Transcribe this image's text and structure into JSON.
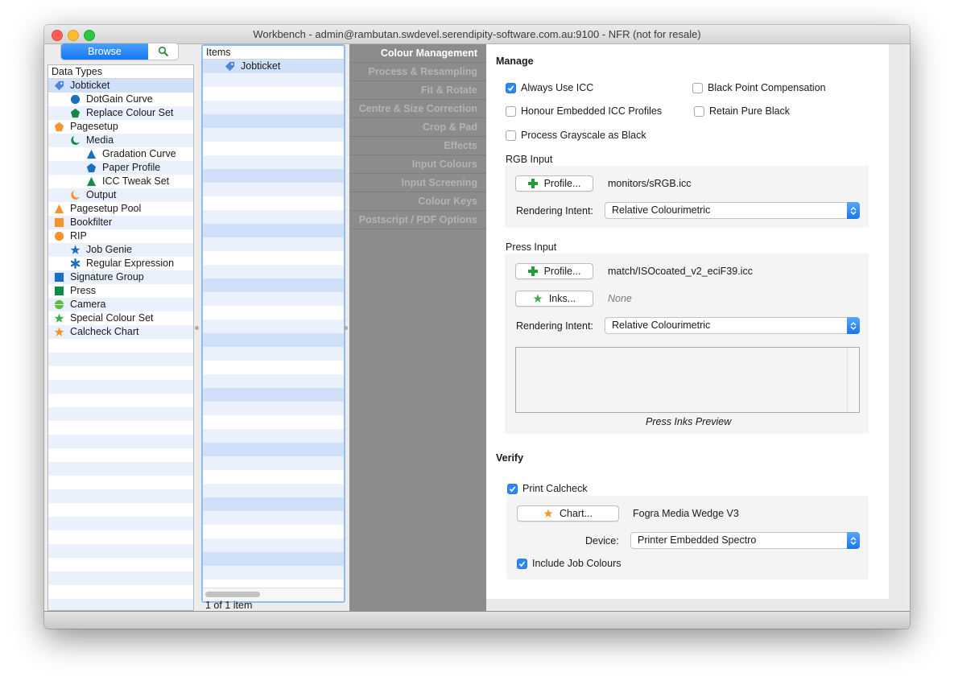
{
  "window": {
    "title": "Workbench - admin@rambutan.swdevel.serendipity-software.com.au:9100 - NFR (not for resale)"
  },
  "left_pane": {
    "browse_label": "Browse",
    "search_icon": "magnifier-icon",
    "header": "Data Types",
    "items": [
      {
        "label": "Jobticket",
        "icon": "tag-icon",
        "color": "#4f86d9",
        "indent": 0,
        "selected": true
      },
      {
        "label": "DotGain Curve",
        "icon": "circle-icon",
        "color": "#1a6fbf",
        "indent": 1
      },
      {
        "label": "Replace Colour Set",
        "icon": "pentagon-icon",
        "color": "#138a43",
        "indent": 1
      },
      {
        "label": "Pagesetup",
        "icon": "pentagon-icon",
        "color": "#f6932b",
        "indent": 0
      },
      {
        "label": "Media",
        "icon": "crescent-icon",
        "color": "#138a43",
        "indent": 1
      },
      {
        "label": "Gradation Curve",
        "icon": "triangle-icon",
        "color": "#1a6fbf",
        "indent": 2
      },
      {
        "label": "Paper Profile",
        "icon": "pentagon-icon",
        "color": "#1a6fbf",
        "indent": 2
      },
      {
        "label": "ICC Tweak Set",
        "icon": "triangle-icon",
        "color": "#138a43",
        "indent": 2
      },
      {
        "label": "Output",
        "icon": "crescent-icon",
        "color": "#f6932b",
        "indent": 1
      },
      {
        "label": "Pagesetup Pool",
        "icon": "triangle-icon",
        "color": "#f6932b",
        "indent": 0
      },
      {
        "label": "Bookfilter",
        "icon": "square-icon",
        "color": "#f6932b",
        "indent": 0
      },
      {
        "label": "RIP",
        "icon": "circle-icon",
        "color": "#f6932b",
        "indent": 0
      },
      {
        "label": "Job Genie",
        "icon": "star-icon",
        "color": "#1a6fbf",
        "indent": 1
      },
      {
        "label": "Regular Expression",
        "icon": "asterisk-icon",
        "color": "#1a6fbf",
        "indent": 1
      },
      {
        "label": "Signature Group",
        "icon": "square-icon",
        "color": "#1a6fbf",
        "indent": 0
      },
      {
        "label": "Press",
        "icon": "square-icon",
        "color": "#138a43",
        "indent": 0
      },
      {
        "label": "Camera",
        "icon": "half-circle-icon",
        "color": "#5cbf3f",
        "indent": 0
      },
      {
        "label": "Special Colour Set",
        "icon": "star-icon",
        "color": "#3fae4a",
        "indent": 0
      },
      {
        "label": "Calcheck Chart",
        "icon": "star-icon",
        "color": "#f6932b",
        "indent": 0
      }
    ]
  },
  "items_pane": {
    "header": "Items",
    "items": [
      {
        "label": "Jobticket",
        "icon": "tag-icon",
        "color": "#4f86d9",
        "selected": true
      }
    ],
    "count": "1 of 1 item"
  },
  "sections": {
    "items": [
      {
        "label": "Colour Management",
        "active": true
      },
      {
        "label": "Process & Resampling"
      },
      {
        "label": "Fit & Rotate"
      },
      {
        "label": "Centre & Size Correction"
      },
      {
        "label": "Crop & Pad"
      },
      {
        "label": "Effects"
      },
      {
        "label": "Input Colours"
      },
      {
        "label": "Input Screening"
      },
      {
        "label": "Colour Keys"
      },
      {
        "label": "Postscript / PDF Options"
      }
    ]
  },
  "manage": {
    "title": "Manage",
    "always_use_icc": {
      "label": "Always Use ICC",
      "checked": true
    },
    "black_point": {
      "label": "Black Point Compensation",
      "checked": false
    },
    "honour_embedded": {
      "label": "Honour Embedded ICC Profiles",
      "checked": false
    },
    "retain_black": {
      "label": "Retain Pure Black",
      "checked": false
    },
    "process_gray": {
      "label": "Process Grayscale as Black",
      "checked": false
    },
    "rgb_input": {
      "title": "RGB Input",
      "profile_button": "Profile...",
      "profile_value": "monitors/sRGB.icc",
      "intent_label": "Rendering Intent:",
      "intent_value": "Relative Colourimetric"
    },
    "press_input": {
      "title": "Press Input",
      "profile_button": "Profile...",
      "profile_value": "match/ISOcoated_v2_eciF39.icc",
      "inks_button": "Inks...",
      "inks_value": "None",
      "intent_label": "Rendering Intent:",
      "intent_value": "Relative Colourimetric",
      "preview_caption": "Press Inks Preview"
    }
  },
  "verify": {
    "title": "Verify",
    "print_calcheck": {
      "label": "Print Calcheck",
      "checked": true
    },
    "chart_button": "Chart...",
    "chart_value": "Fogra Media Wedge V3",
    "device_label": "Device:",
    "device_value": "Printer Embedded Spectro",
    "include_job_colours": {
      "label": "Include Job Colours",
      "checked": true
    }
  },
  "colors": {
    "accent": "#2f88f0",
    "green_plus": "#1f9d3a",
    "star_green": "#3fae4a",
    "star_orange": "#f6932b"
  }
}
